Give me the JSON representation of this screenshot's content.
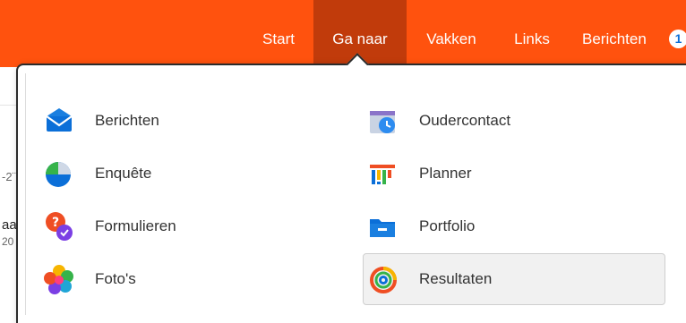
{
  "nav": {
    "items": [
      {
        "label": "Start"
      },
      {
        "label": "Ga naar"
      },
      {
        "label": "Vakken"
      },
      {
        "label": "Links"
      },
      {
        "label": "Berichten"
      }
    ],
    "messages_badge": "1",
    "active_item": "Ga naar"
  },
  "background_fragments": [
    "-2¨",
    "aa",
    "20"
  ],
  "menu": {
    "left_column": [
      {
        "label": "Berichten",
        "icon": "envelope-icon"
      },
      {
        "label": "Enquête",
        "icon": "pie-chart-icon"
      },
      {
        "label": "Formulieren",
        "icon": "form-bubbles-icon"
      },
      {
        "label": "Foto's",
        "icon": "photos-flower-icon"
      }
    ],
    "right_column": [
      {
        "label": "Oudercontact",
        "icon": "calendar-clock-icon"
      },
      {
        "label": "Planner",
        "icon": "planner-columns-icon"
      },
      {
        "label": "Portfolio",
        "icon": "folder-icon"
      },
      {
        "label": "Resultaten",
        "icon": "rings-icon"
      }
    ],
    "selected": "Resultaten"
  },
  "colors": {
    "brand_orange": "#ff520e",
    "active_nav": "#c13b0b",
    "icon_blue": "#0b6fd8"
  }
}
